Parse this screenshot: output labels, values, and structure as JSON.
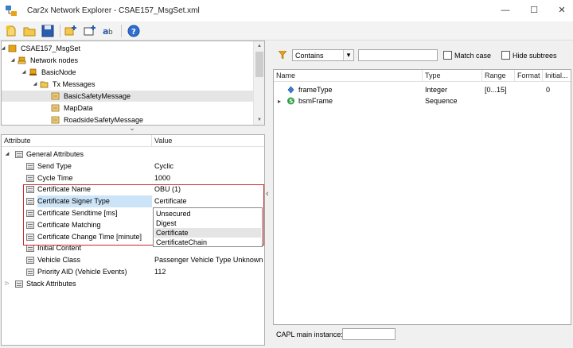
{
  "window": {
    "title": "Car2x Network Explorer - CSAE157_MsgSet.xml",
    "minimize_glyph": "—",
    "maximize_glyph": "☐",
    "close_glyph": "✕"
  },
  "toolbar": {
    "buttons": [
      "new-icon",
      "open-icon",
      "save-icon",
      "add-node-icon",
      "add-message-icon",
      "find-replace-icon",
      "help-icon"
    ]
  },
  "tree": {
    "items": [
      {
        "label": "CSAE157_MsgSet",
        "expander": "◢",
        "icon": "database-icon"
      },
      {
        "label": "Network nodes",
        "expander": "◢",
        "icon": "node-group-icon"
      },
      {
        "label": "BasicNode",
        "expander": "◢",
        "icon": "node-icon"
      },
      {
        "label": "Tx Messages",
        "expander": "◢",
        "icon": "tx-folder-icon"
      },
      {
        "label": "BasicSafetyMessage",
        "expander": "",
        "icon": "message-icon"
      },
      {
        "label": "MapData",
        "expander": "",
        "icon": "message-icon"
      },
      {
        "label": "RoadsideSafetyMessage",
        "expander": "",
        "icon": "message-icon"
      }
    ]
  },
  "splitter": {
    "up_glyph": "⌄",
    "left_glyph": "‹"
  },
  "attributes": {
    "headers": {
      "attribute": "Attribute",
      "value": "Value"
    },
    "rows": [
      {
        "attribute": "General Attributes",
        "value": "",
        "expander": "◢"
      },
      {
        "attribute": "Send Type",
        "value": "Cyclic",
        "expander": ""
      },
      {
        "attribute": "Cycle Time",
        "value": "1000",
        "expander": ""
      },
      {
        "attribute": "Certificate Name",
        "value": "OBU (1)",
        "expander": ""
      },
      {
        "attribute": "Certificate Signer Type",
        "value": "Certificate",
        "expander": ""
      },
      {
        "attribute": "Certificate Sendtime [ms]",
        "value": "",
        "expander": ""
      },
      {
        "attribute": "Certificate Matching",
        "value": "",
        "expander": ""
      },
      {
        "attribute": "Certificate Change Time [minute]",
        "value": "",
        "expander": ""
      },
      {
        "attribute": "Initial Content",
        "value": "",
        "expander": ""
      },
      {
        "attribute": "Vehicle Class",
        "value": "Passenger Vehicle Type Unknown",
        "expander": ""
      },
      {
        "attribute": "Priority AID (Vehicle Events)",
        "value": "112",
        "expander": ""
      },
      {
        "attribute": "Stack Attributes",
        "value": "",
        "expander": "▷"
      }
    ],
    "signer_dropdown": {
      "options": [
        "Unsecured",
        "Digest",
        "Certificate",
        "CertificateChain"
      ],
      "highlighted": "Certificate"
    }
  },
  "filter": {
    "filter_icon": "filter-icon",
    "mode": "Contains",
    "mode_arrow": "▾",
    "search_value": "",
    "match_case": "Match case",
    "hide_subtrees": "Hide subtrees"
  },
  "signals": {
    "headers": [
      "Name",
      "Type",
      "Range",
      "Format",
      "Initial..."
    ],
    "rows": [
      {
        "name": "frameType",
        "type": "Integer",
        "range": "[0...15]",
        "format": "",
        "initial": "0",
        "expander": "",
        "icon": "signal-icon"
      },
      {
        "name": "bsmFrame",
        "type": "Sequence",
        "range": "",
        "format": "",
        "initial": "",
        "expander": "▸",
        "icon": "sequence-icon"
      }
    ]
  },
  "capl": {
    "label": "CAPL main instance:",
    "value": ""
  },
  "colors": {
    "selection": "#cce4f7",
    "highlight": "#e5e5e5",
    "red_box": "#c8282d",
    "accent": "#0078d7"
  }
}
